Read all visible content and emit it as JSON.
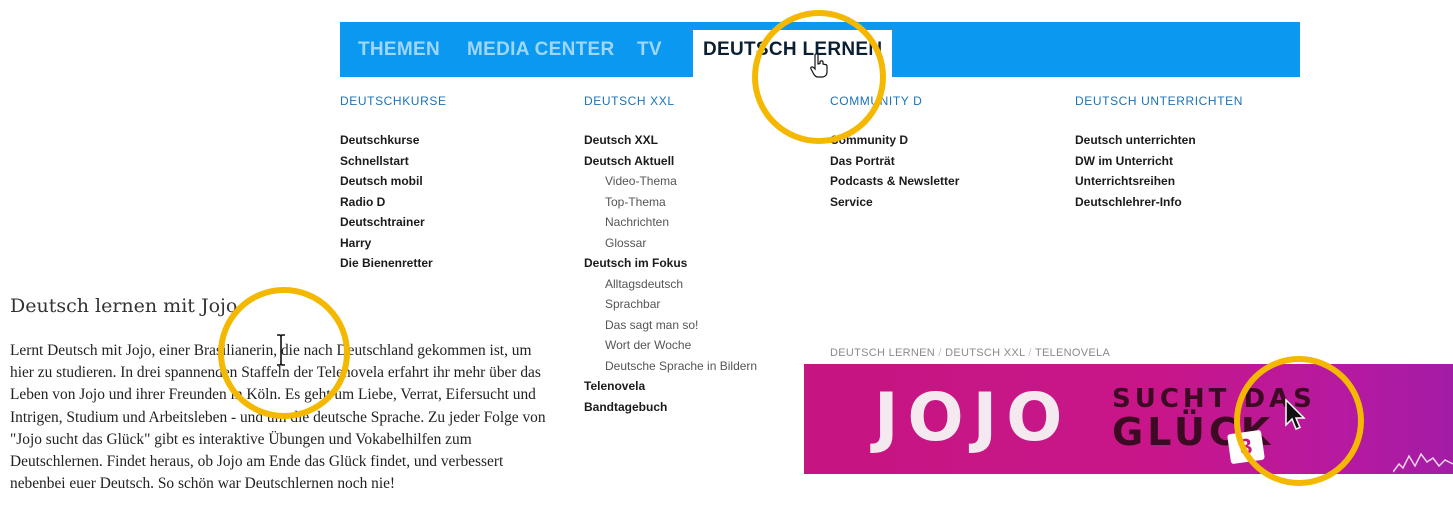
{
  "nav": {
    "items": [
      "THEMEN",
      "MEDIA CENTER",
      "TV"
    ],
    "active": "DEUTSCH LERNEN"
  },
  "menu": {
    "columns": [
      {
        "heading": "DEUTSCHKURSE",
        "items": [
          {
            "label": "Deutschkurse",
            "sub": false
          },
          {
            "label": "Schnellstart",
            "sub": false
          },
          {
            "label": "Deutsch mobil",
            "sub": false
          },
          {
            "label": "Radio D",
            "sub": false
          },
          {
            "label": "Deutschtrainer",
            "sub": false
          },
          {
            "label": "Harry",
            "sub": false
          },
          {
            "label": "Die Bienenretter",
            "sub": false
          }
        ]
      },
      {
        "heading": "DEUTSCH XXL",
        "items": [
          {
            "label": "Deutsch XXL",
            "sub": false
          },
          {
            "label": "Deutsch Aktuell",
            "sub": false
          },
          {
            "label": "Video-Thema",
            "sub": true
          },
          {
            "label": "Top-Thema",
            "sub": true
          },
          {
            "label": "Nachrichten",
            "sub": true
          },
          {
            "label": "Glossar",
            "sub": true
          },
          {
            "label": "Deutsch im Fokus",
            "sub": false
          },
          {
            "label": "Alltagsdeutsch",
            "sub": true
          },
          {
            "label": "Sprachbar",
            "sub": true
          },
          {
            "label": "Das sagt man so!",
            "sub": true
          },
          {
            "label": "Wort der Woche",
            "sub": true
          },
          {
            "label": "Deutsche Sprache in Bildern",
            "sub": true
          },
          {
            "label": "Telenovela",
            "sub": false
          },
          {
            "label": "Bandtagebuch",
            "sub": false
          }
        ]
      },
      {
        "heading": "COMMUNITY D",
        "items": [
          {
            "label": "Community D",
            "sub": false
          },
          {
            "label": "Das Porträt",
            "sub": false
          },
          {
            "label": "Podcasts & Newsletter",
            "sub": false
          },
          {
            "label": "Service",
            "sub": false
          }
        ]
      },
      {
        "heading": "DEUTSCH UNTERRICHTEN",
        "items": [
          {
            "label": "Deutsch unterrichten",
            "sub": false
          },
          {
            "label": "DW im Unterricht",
            "sub": false
          },
          {
            "label": "Unterrichtsreihen",
            "sub": false
          },
          {
            "label": "Deutschlehrer-Info",
            "sub": false
          }
        ]
      }
    ]
  },
  "article": {
    "title": "Deutsch lernen mit Jojo",
    "body": "Lernt Deutsch mit Jojo, einer Brasilianerin, die nach Deutschland gekommen ist, um hier zu studieren. In drei spannenden Staffeln der Telenovela erfahrt ihr mehr über das Leben von Jojo und ihrer Freunden in Köln. Es geht um Liebe, Verrat, Eifersucht und Intrigen, Studium und Arbeitsleben - und um die deutsche Sprache. Zu jeder Folge von \"Jojo sucht das Glück\" gibt es interaktive Übungen und Vokabelhilfen zum Deutschlernen. Findet heraus, ob Jojo am Ende das Glück findet, und verbessert nebenbei euer Deutsch. So schön war Deutschlernen noch nie!"
  },
  "breadcrumb": [
    "DEUTSCH LERNEN",
    "DEUTSCH XXL",
    "TELENOVELA"
  ],
  "banner": {
    "title": "JOJO",
    "line1": "SUCHT DAS",
    "line2": "GLÜCK",
    "badge": "3"
  },
  "colors": {
    "nav_bg": "#0a98f0",
    "heading": "#1a73bb",
    "highlight": "#f5b800",
    "banner": "#c61581"
  },
  "icons": [
    "hand-pointer-icon",
    "text-cursor-icon",
    "arrow-pointer-icon"
  ]
}
